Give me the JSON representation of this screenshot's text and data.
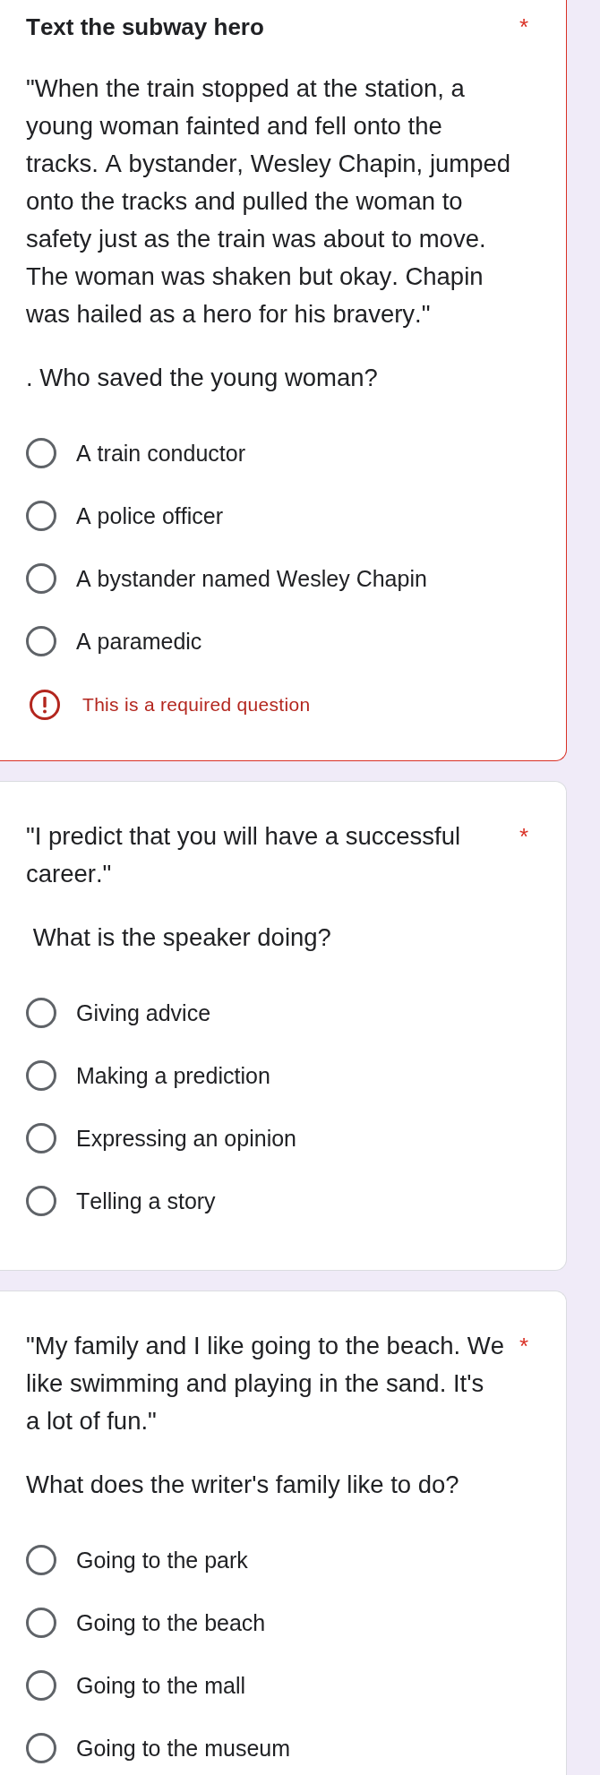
{
  "questions": [
    {
      "heading": "Text the subway hero",
      "required_mark": "*",
      "passage": "\"When the train stopped at the station, a young woman fainted and fell onto the tracks. A bystander, Wesley Chapin, jumped onto the tracks and pulled the woman to safety just as the train was about to move. The woman was shaken but okay. Chapin was hailed as a hero for his bravery.\"",
      "prompt": ". Who saved the young woman?",
      "options": [
        {
          "label": "A train conductor",
          "selected": false
        },
        {
          "label": "A police officer",
          "selected": false
        },
        {
          "label": "A bystander named Wesley Chapin",
          "selected": false
        },
        {
          "label": "A paramedic",
          "selected": false
        }
      ],
      "error": "This is a required question"
    },
    {
      "required_mark": "*",
      "passage": "\"I predict that you will have a successful career.\"",
      "prompt": " What is the speaker doing?",
      "options": [
        {
          "label": "Giving advice",
          "selected": false
        },
        {
          "label": "Making a prediction",
          "selected": false
        },
        {
          "label": "Expressing an opinion",
          "selected": false
        },
        {
          "label": "Telling a story",
          "selected": false
        }
      ]
    },
    {
      "required_mark": "*",
      "passage": "\"My family and I like going to the beach. We like swimming and playing in the sand. It's\na lot of fun.\"",
      "prompt": "What does the writer's family like to do?",
      "options": [
        {
          "label": "Going to the park",
          "selected": false
        },
        {
          "label": "Going to the beach",
          "selected": false
        },
        {
          "label": "Going to the mall",
          "selected": false
        },
        {
          "label": "Going to the museum",
          "selected": false
        }
      ]
    }
  ]
}
